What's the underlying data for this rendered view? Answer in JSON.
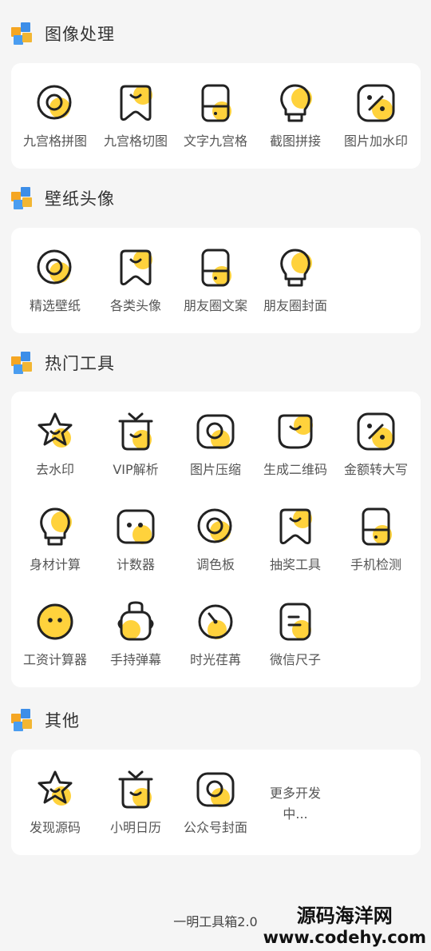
{
  "sections": [
    {
      "title": "图像处理",
      "items": [
        "九宫格拼图",
        "九宫格切图",
        "文字九宫格",
        "截图拼接",
        "图片加水印"
      ]
    },
    {
      "title": "壁纸头像",
      "items": [
        "精选壁纸",
        "各类头像",
        "朋友圈文案",
        "朋友圈封面"
      ]
    },
    {
      "title": "热门工具",
      "items": [
        "去水印",
        "VIP解析",
        "图片压缩",
        "生成二维码",
        "金额转大写",
        "身材计算",
        "计数器",
        "调色板",
        "抽奖工具",
        "手机检测",
        "工资计算器",
        "手持弹幕",
        "时光荏苒",
        "微信尺子"
      ]
    },
    {
      "title": "其他",
      "items": [
        "发现源码",
        "小明日历",
        "公众号封面"
      ],
      "more": "更多开发中..."
    }
  ],
  "icons": {
    "s0": [
      "ring-icon",
      "tooth-icon",
      "phone-icon",
      "bulb-icon",
      "percent-icon"
    ],
    "s1": [
      "ring-icon",
      "tooth-icon",
      "phone-icon",
      "bulb-icon"
    ],
    "s2": [
      "star-icon",
      "tv-icon",
      "camera-icon",
      "smile-icon",
      "percent-icon",
      "bulb-icon",
      "face-icon",
      "ring-icon",
      "tooth-icon",
      "phone-icon",
      "emoji-icon",
      "handbag-icon",
      "dial-icon",
      "note-icon"
    ],
    "s3": [
      "star-icon",
      "tv-icon",
      "camera-icon"
    ]
  },
  "footer": {
    "app_name": "一明工具箱2.0"
  },
  "watermark": {
    "line1": "源码海洋网",
    "line2": "www.codehy.com"
  },
  "colors": {
    "accent": "#ffd23c",
    "stroke": "#222222",
    "card": "#ffffff",
    "background": "#f5f5f5"
  }
}
